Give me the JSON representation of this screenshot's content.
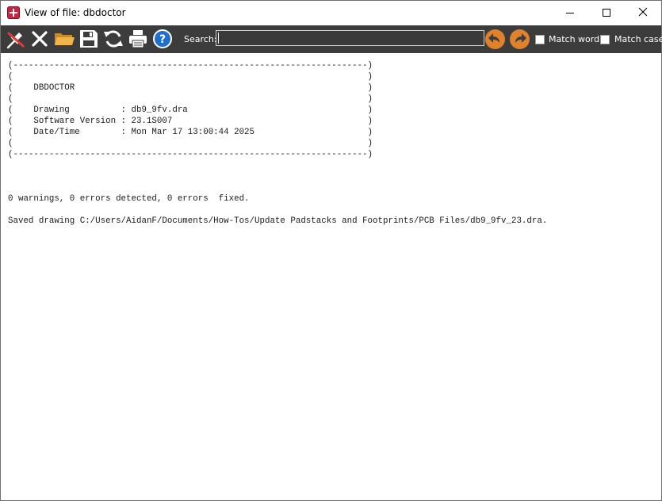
{
  "window": {
    "title": "View of file: dbdoctor",
    "app_icon": "app-logo-icon",
    "controls": [
      "minimize-icon",
      "maximize-icon",
      "close-icon"
    ]
  },
  "toolbar": {
    "buttons": [
      {
        "name": "pin-button",
        "icon": "pin-icon"
      },
      {
        "name": "close-file-button",
        "icon": "x-icon"
      },
      {
        "name": "open-button",
        "icon": "folder-icon"
      },
      {
        "name": "save-button",
        "icon": "floppy-disk-icon"
      },
      {
        "name": "refresh-button",
        "icon": "refresh-icon"
      },
      {
        "name": "print-button",
        "icon": "printer-icon"
      },
      {
        "name": "help-button",
        "icon": "help-icon"
      }
    ],
    "search_label": "Search:",
    "search_value": "",
    "prev_icon": "arrow-left-icon",
    "next_icon": "arrow-right-icon",
    "match_word_label": "Match word",
    "match_word_checked": false,
    "match_case_label": "Match case",
    "match_case_checked": false,
    "accent_color": "#e0822b",
    "toolbar_bg": "#3c3c3c"
  },
  "log": {
    "lines": [
      "(---------------------------------------------------------------------)",
      "(                                                                     )",
      "(    DBDOCTOR                                                         )",
      "(                                                                     )",
      "(    Drawing          : db9_9fv.dra                                   )",
      "(    Software Version : 23.1S007                                      )",
      "(    Date/Time        : Mon Mar 17 13:00:44 2025                      )",
      "(                                                                     )",
      "(---------------------------------------------------------------------)",
      "",
      "",
      "",
      "0 warnings, 0 errors detected, 0 errors  fixed.",
      "",
      "Saved drawing C:/Users/AidanF/Documents/How-Tos/Update Padstacks and Footprints/PCB Files/db9_9fv_23.dra."
    ]
  }
}
